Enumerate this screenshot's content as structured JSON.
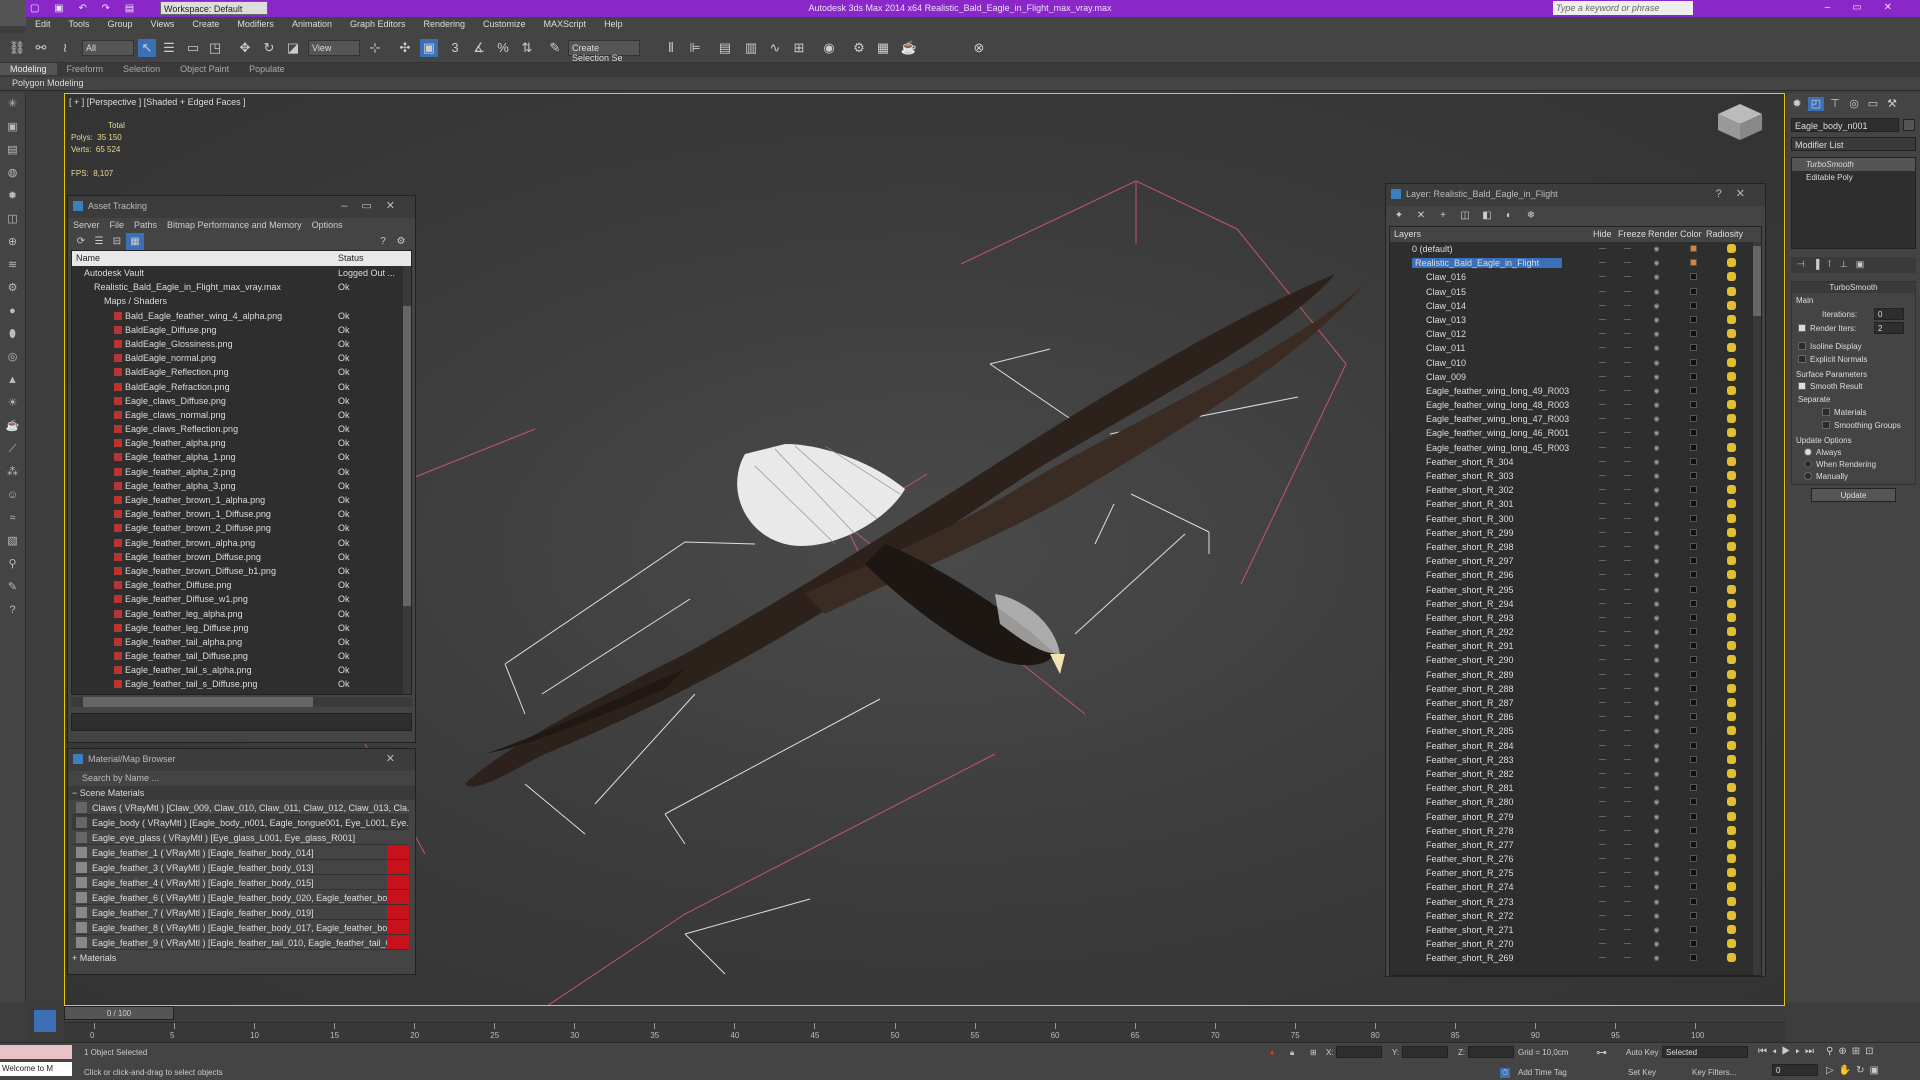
{
  "titlebar": {
    "title": "Autodesk 3ds Max 2014 x64      Realistic_Bald_Eagle_in_Flight_max_vray.max",
    "workspace": "Workspace: Default",
    "search_placeholder": "Type a keyword or phrase"
  },
  "menu": [
    "Edit",
    "Tools",
    "Group",
    "Views",
    "Create",
    "Modifiers",
    "Animation",
    "Graph Editors",
    "Rendering",
    "Customize",
    "MAXScript",
    "Help"
  ],
  "toolbar": {
    "filter": "All",
    "refcoord": "View",
    "selset": "Create Selection Se",
    "snap": "3"
  },
  "ribbon": {
    "tabs": [
      "Modeling",
      "Freeform",
      "Selection",
      "Object Paint",
      "Populate"
    ],
    "sub": "Polygon Modeling"
  },
  "viewport": {
    "label": "[ + ] [Perspective ] [Shaded + Edged Faces ]",
    "stats": {
      "total": "Total",
      "polys_label": "Polys:",
      "polys": "35 150",
      "verts_label": "Verts:",
      "verts": "65 524",
      "fps_label": "FPS:",
      "fps": "8,107"
    }
  },
  "asset_tracking": {
    "title": "Asset Tracking",
    "menu": [
      "Server",
      "File",
      "Paths",
      "Bitmap Performance and Memory",
      "Options"
    ],
    "col_name": "Name",
    "col_status": "Status",
    "rows": [
      {
        "name": "Autodesk Vault",
        "status": "Logged Out ...",
        "indent": 1
      },
      {
        "name": "Realistic_Bald_Eagle_in_Flight_max_vray.max",
        "status": "Ok",
        "indent": 2
      },
      {
        "name": "Maps / Shaders",
        "status": "",
        "indent": 3
      },
      {
        "name": "Bald_Eagle_feather_wing_4_alpha.png",
        "status": "Ok",
        "indent": 4
      },
      {
        "name": "BaldEagle_Diffuse.png",
        "status": "Ok",
        "indent": 4
      },
      {
        "name": "BaldEagle_Glossiness.png",
        "status": "Ok",
        "indent": 4
      },
      {
        "name": "BaldEagle_normal.png",
        "status": "Ok",
        "indent": 4
      },
      {
        "name": "BaldEagle_Reflection.png",
        "status": "Ok",
        "indent": 4
      },
      {
        "name": "BaldEagle_Refraction.png",
        "status": "Ok",
        "indent": 4
      },
      {
        "name": "Eagle_claws_Diffuse.png",
        "status": "Ok",
        "indent": 4
      },
      {
        "name": "Eagle_claws_normal.png",
        "status": "Ok",
        "indent": 4
      },
      {
        "name": "Eagle_claws_Reflection.png",
        "status": "Ok",
        "indent": 4
      },
      {
        "name": "Eagle_feather_alpha.png",
        "status": "Ok",
        "indent": 4
      },
      {
        "name": "Eagle_feather_alpha_1.png",
        "status": "Ok",
        "indent": 4
      },
      {
        "name": "Eagle_feather_alpha_2.png",
        "status": "Ok",
        "indent": 4
      },
      {
        "name": "Eagle_feather_alpha_3.png",
        "status": "Ok",
        "indent": 4
      },
      {
        "name": "Eagle_feather_brown_1_alpha.png",
        "status": "Ok",
        "indent": 4
      },
      {
        "name": "Eagle_feather_brown_1_Diffuse.png",
        "status": "Ok",
        "indent": 4
      },
      {
        "name": "Eagle_feather_brown_2_Diffuse.png",
        "status": "Ok",
        "indent": 4
      },
      {
        "name": "Eagle_feather_brown_alpha.png",
        "status": "Ok",
        "indent": 4
      },
      {
        "name": "Eagle_feather_brown_Diffuse.png",
        "status": "Ok",
        "indent": 4
      },
      {
        "name": "Eagle_feather_brown_Diffuse_b1.png",
        "status": "Ok",
        "indent": 4
      },
      {
        "name": "Eagle_feather_Diffuse.png",
        "status": "Ok",
        "indent": 4
      },
      {
        "name": "Eagle_feather_Diffuse_w1.png",
        "status": "Ok",
        "indent": 4
      },
      {
        "name": "Eagle_feather_leg_alpha.png",
        "status": "Ok",
        "indent": 4
      },
      {
        "name": "Eagle_feather_leg_Diffuse.png",
        "status": "Ok",
        "indent": 4
      },
      {
        "name": "Eagle_feather_tail_alpha.png",
        "status": "Ok",
        "indent": 4
      },
      {
        "name": "Eagle_feather_tail_Diffuse.png",
        "status": "Ok",
        "indent": 4
      },
      {
        "name": "Eagle_feather_tail_s_alpha.png",
        "status": "Ok",
        "indent": 4
      },
      {
        "name": "Eagle_feather_tail_s_Diffuse.png",
        "status": "Ok",
        "indent": 4
      }
    ]
  },
  "material_browser": {
    "title": "Material/Map Browser",
    "search": "Search by Name ...",
    "section": "Scene Materials",
    "section2": "+ Materials",
    "rows": [
      "Claws  ( VRayMtl )  [Claw_009, Claw_010, Claw_011, Claw_012, Claw_013, Cla...",
      "Eagle_body  ( VRayMtl )  [Eagle_body_n001, Eagle_tongue001, Eye_L001, Eye...",
      "Eagle_eye_glass  ( VRayMtl )  [Eye_glass_L001, Eye_glass_R001]",
      "Eagle_feather_1  ( VRayMtl )  [Eagle_feather_body_014]",
      "Eagle_feather_3  ( VRayMtl )  [Eagle_feather_body_013]",
      "Eagle_feather_4  ( VRayMtl )  [Eagle_feather_body_015]",
      "Eagle_feather_6  ( VRayMtl )  [Eagle_feather_body_020, Eagle_feather_body_...",
      "Eagle_feather_7  ( VRayMtl )  [Eagle_feather_body_019]",
      "Eagle_feather_8  ( VRayMtl )  [Eagle_feather_body_017, Eagle_feather_body_...",
      "Eagle_feather_9  ( VRayMtl )  [Eagle_feather_tail_010, Eagle_feather_tail_011,..."
    ]
  },
  "layer_explorer": {
    "title": "Layer: Realistic_Bald_Eagle_in_Flight",
    "col_layers": "Layers",
    "col_hide": "Hide",
    "col_freeze": "Freeze",
    "col_render": "Render",
    "col_color": "Color",
    "col_radiosity": "Radiosity",
    "rows": [
      "0 (default)",
      "Realistic_Bald_Eagle_in_Flight",
      "Claw_016",
      "Claw_015",
      "Claw_014",
      "Claw_013",
      "Claw_012",
      "Claw_011",
      "Claw_010",
      "Claw_009",
      "Eagle_feather_wing_long_49_R003",
      "Eagle_feather_wing_long_48_R003",
      "Eagle_feather_wing_long_47_R003",
      "Eagle_feather_wing_long_46_R001",
      "Eagle_feather_wing_long_45_R003",
      "Feather_short_R_304",
      "Feather_short_R_303",
      "Feather_short_R_302",
      "Feather_short_R_301",
      "Feather_short_R_300",
      "Feather_short_R_299",
      "Feather_short_R_298",
      "Feather_short_R_297",
      "Feather_short_R_296",
      "Feather_short_R_295",
      "Feather_short_R_294",
      "Feather_short_R_293",
      "Feather_short_R_292",
      "Feather_short_R_291",
      "Feather_short_R_290",
      "Feather_short_R_289",
      "Feather_short_R_288",
      "Feather_short_R_287",
      "Feather_short_R_286",
      "Feather_short_R_285",
      "Feather_short_R_284",
      "Feather_short_R_283",
      "Feather_short_R_282",
      "Feather_short_R_281",
      "Feather_short_R_280",
      "Feather_short_R_279",
      "Feather_short_R_278",
      "Feather_short_R_277",
      "Feather_short_R_276",
      "Feather_short_R_275",
      "Feather_short_R_274",
      "Feather_short_R_273",
      "Feather_short_R_272",
      "Feather_short_R_271",
      "Feather_short_R_270",
      "Feather_short_R_269"
    ]
  },
  "command_panel": {
    "object_name": "Eagle_body_n001",
    "modifier_list": "Modifier List",
    "stack": [
      "TurboSmooth",
      "Editable Poly"
    ],
    "rollout": "TurboSmooth",
    "main": "Main",
    "iterations_label": "Iterations:",
    "iterations": "0",
    "render_iters_label": "Render Iters:",
    "render_iters": "2",
    "isoline": "Isoline Display",
    "explicit": "Explicit Normals",
    "surface": "Surface Parameters",
    "smooth": "Smooth Result",
    "separate": "Separate",
    "materials": "Materials",
    "smoothing_groups": "Smoothing Groups",
    "update_options": "Update Options",
    "always": "Always",
    "when_rendering": "When Rendering",
    "manually": "Manually",
    "update": "Update"
  },
  "timeline": {
    "frame": "0 / 100",
    "ticks": [
      0,
      5,
      10,
      15,
      20,
      25,
      30,
      35,
      40,
      45,
      50,
      55,
      60,
      65,
      70,
      75,
      80,
      85,
      90,
      95,
      100
    ]
  },
  "status": {
    "selected": "1 Object Selected",
    "hint": "Click or click-and-drag to select objects",
    "welcome": "Welcome to M",
    "x": "X:",
    "y": "Y:",
    "z": "Z:",
    "grid": "Grid = 10,0cm",
    "autokey": "Auto Key",
    "selected_mode": "Selected",
    "setkey": "Set Key",
    "keyfilters": "Key Filters...",
    "addtimetag": "Add Time Tag",
    "frame": "0"
  },
  "colors": {
    "title": "#8a27c8",
    "selection": "#3b6fb6",
    "material_red": "#c8121b",
    "viewport_border": "#e8c700",
    "wireframe": "#c2566e"
  }
}
